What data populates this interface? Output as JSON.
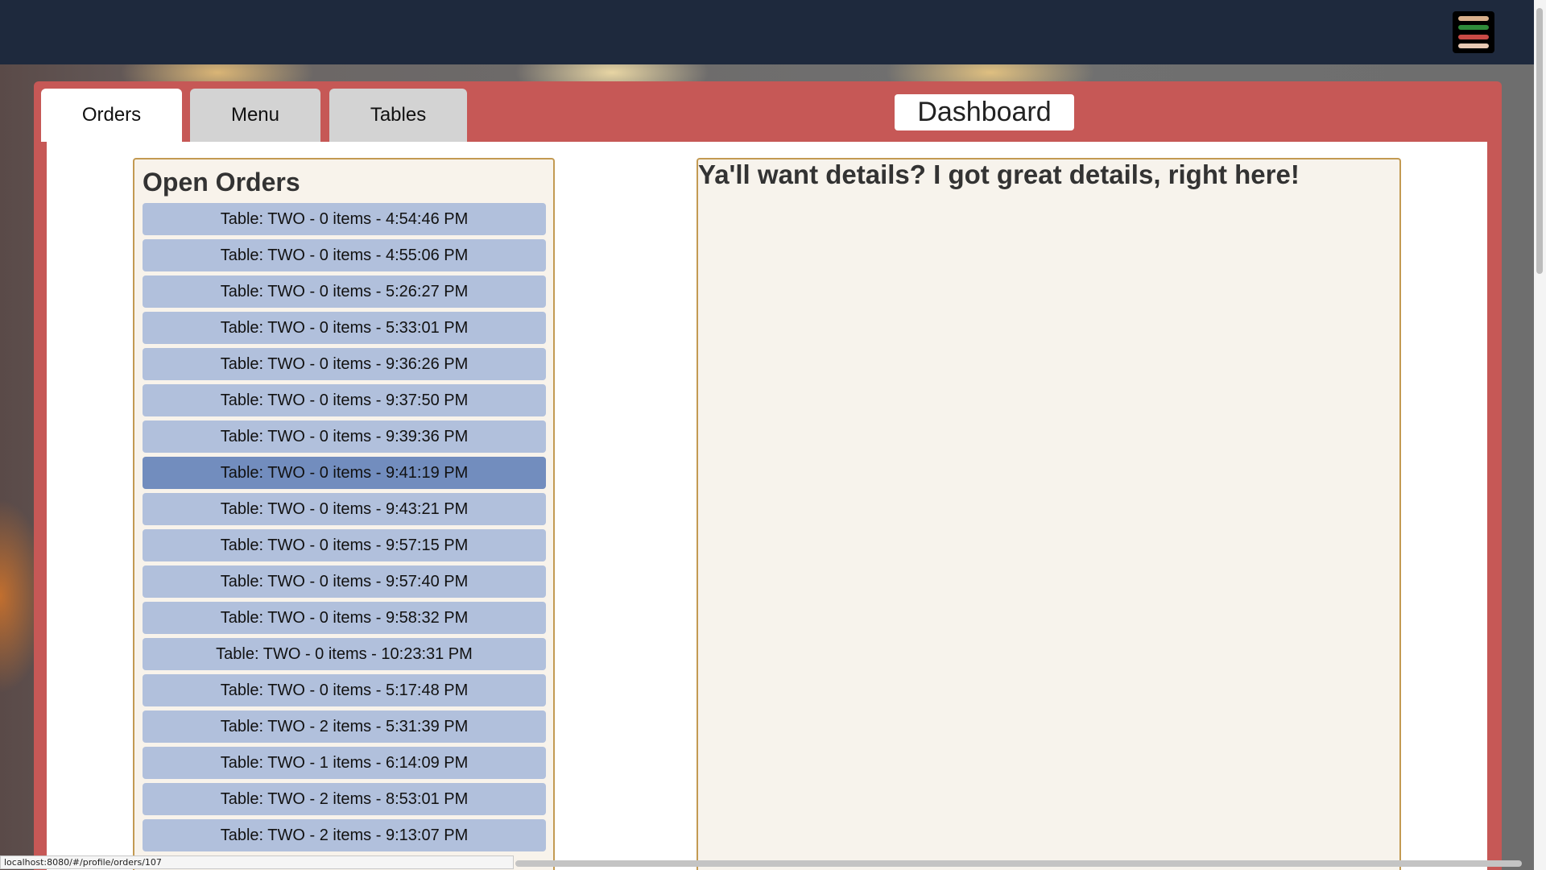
{
  "colors": {
    "topbar": "#1e293d",
    "panel": "#c65856",
    "order_item": "#b1c0dc",
    "order_item_selected": "#728dbe",
    "box_border": "#c39a52",
    "box_bg": "#f8f3eb",
    "hamburger_lines": [
      "#d9b08c",
      "#2e8b3a",
      "#c94a45",
      "#e8c9b4"
    ]
  },
  "header": {
    "menu_icon": "hamburger-icon"
  },
  "tabs": [
    {
      "label": "Orders",
      "active": true
    },
    {
      "label": "Menu",
      "active": false
    },
    {
      "label": "Tables",
      "active": false
    }
  ],
  "dashboard": {
    "label": "Dashboard"
  },
  "orders": {
    "title": "Open Orders",
    "items": [
      {
        "label": "Table: TWO - 0 items - 4:54:46 PM",
        "selected": false
      },
      {
        "label": "Table: TWO - 0 items - 4:55:06 PM",
        "selected": false
      },
      {
        "label": "Table: TWO - 0 items - 5:26:27 PM",
        "selected": false
      },
      {
        "label": "Table: TWO - 0 items - 5:33:01 PM",
        "selected": false
      },
      {
        "label": "Table: TWO - 0 items - 9:36:26 PM",
        "selected": false
      },
      {
        "label": "Table: TWO - 0 items - 9:37:50 PM",
        "selected": false
      },
      {
        "label": "Table: TWO - 0 items - 9:39:36 PM",
        "selected": false
      },
      {
        "label": "Table: TWO - 0 items - 9:41:19 PM",
        "selected": true
      },
      {
        "label": "Table: TWO - 0 items - 9:43:21 PM",
        "selected": false
      },
      {
        "label": "Table: TWO - 0 items - 9:57:15 PM",
        "selected": false
      },
      {
        "label": "Table: TWO - 0 items - 9:57:40 PM",
        "selected": false
      },
      {
        "label": "Table: TWO - 0 items - 9:58:32 PM",
        "selected": false
      },
      {
        "label": "Table: TWO - 0 items - 10:23:31 PM",
        "selected": false
      },
      {
        "label": "Table: TWO - 0 items - 5:17:48 PM",
        "selected": false
      },
      {
        "label": "Table: TWO - 2 items - 5:31:39 PM",
        "selected": false
      },
      {
        "label": "Table: TWO - 1 items - 6:14:09 PM",
        "selected": false
      },
      {
        "label": "Table: TWO - 2 items - 8:53:01 PM",
        "selected": false
      },
      {
        "label": "Table: TWO - 2 items - 9:13:07 PM",
        "selected": false
      }
    ]
  },
  "details": {
    "text": "Ya'll want details? I got great details, right here!"
  },
  "status_bar": {
    "url": "localhost:8080/#/profile/orders/107"
  }
}
